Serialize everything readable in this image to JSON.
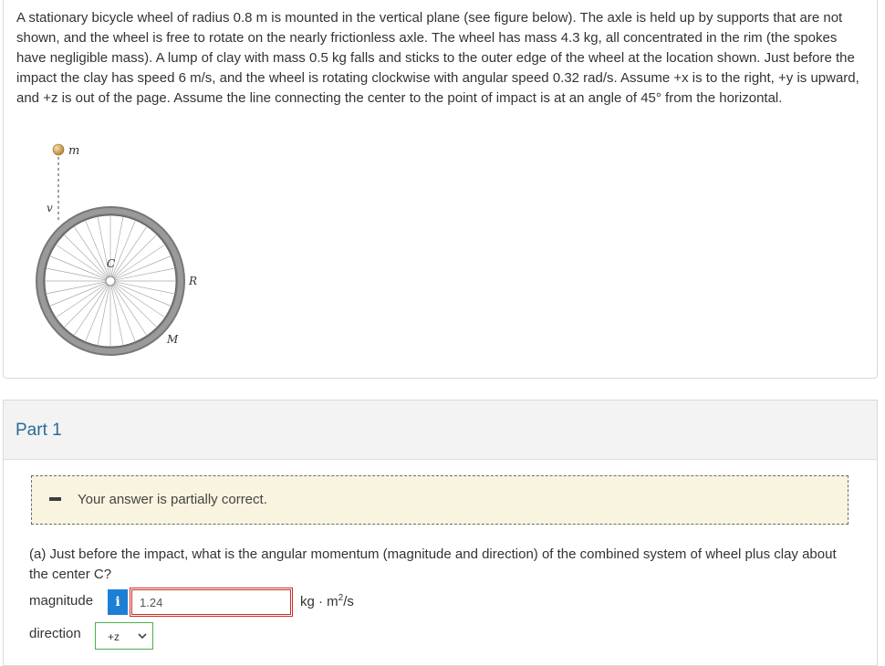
{
  "problem": {
    "text": "A stationary bicycle wheel of radius 0.8 m is mounted in the vertical plane (see figure below). The axle is held up by supports that are not shown, and the wheel is free to rotate on the nearly frictionless axle. The wheel has mass 4.3 kg, all concentrated in the rim (the spokes have negligible mass). A lump of clay with mass 0.5 kg falls and sticks to the outer edge of the wheel at the location shown. Just before the impact the clay has speed 6 m/s, and the wheel is rotating clockwise with angular speed 0.32 rad/s. Assume +x is to the right, +y is upward, and +z is out of the page. Assume the line connecting the center to the point of impact is at an angle of 45° from the horizontal."
  },
  "figure": {
    "label_m": "m",
    "label_v": "v",
    "label_c": "C",
    "label_r": "R",
    "label_M": "M"
  },
  "part": {
    "title": "Part 1",
    "feedback": "Your answer is partially correct.",
    "question": "(a) Just before the impact, what is the angular momentum (magnitude and direction) of the combined system of wheel plus clay about the center C?",
    "magnitude_label": "magnitude",
    "info_icon": "i",
    "magnitude_value": "1.24",
    "unit_prefix": "kg · m",
    "unit_exp": "2",
    "unit_suffix": "/s",
    "direction_label": "direction",
    "direction_value": "+z"
  }
}
